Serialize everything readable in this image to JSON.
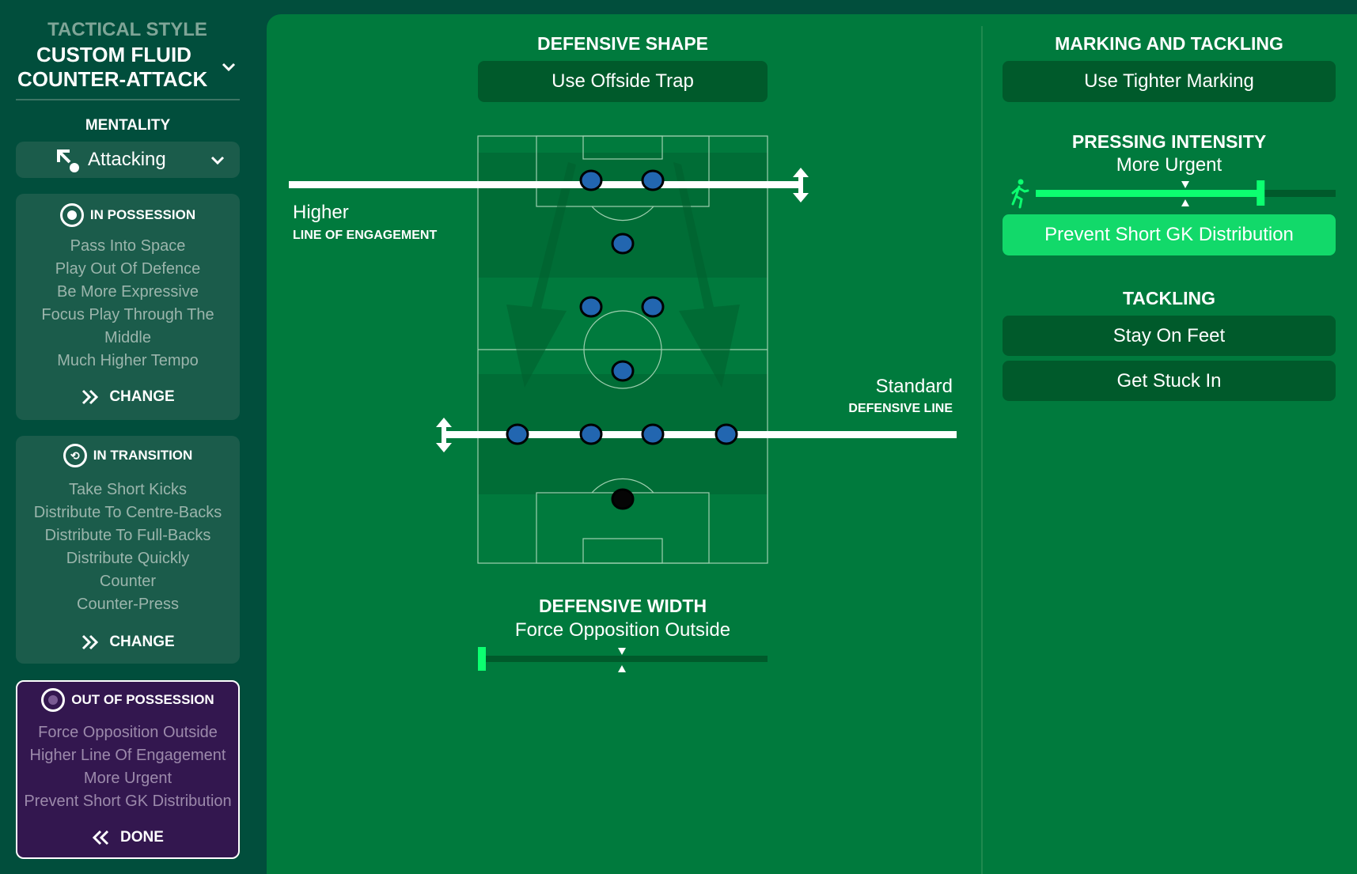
{
  "sidebar": {
    "tactical_style_label": "TACTICAL STYLE",
    "style_name_line1": "CUSTOM FLUID",
    "style_name_line2": "COUNTER-ATTACK",
    "mentality_label": "MENTALITY",
    "mentality_value": "Attacking",
    "in_possession": {
      "title": "IN POSSESSION",
      "items": [
        "Pass Into Space",
        "Play Out Of Defence",
        "Be More Expressive",
        "Focus Play Through The",
        "Middle",
        "Much Higher Tempo"
      ],
      "action": "CHANGE"
    },
    "in_transition": {
      "title": "IN TRANSITION",
      "items": [
        "Take Short Kicks",
        "Distribute To Centre-Backs",
        "Distribute To Full-Backs",
        "Distribute Quickly",
        "Counter",
        "Counter-Press"
      ],
      "action": "CHANGE"
    },
    "out_of_possession": {
      "title": "OUT OF POSSESSION",
      "items": [
        "Force Opposition Outside",
        "Higher Line Of Engagement",
        "More Urgent",
        "Prevent Short GK Distribution"
      ],
      "action": "DONE"
    }
  },
  "defensive_shape": {
    "title": "DEFENSIVE SHAPE",
    "offside_trap": "Use Offside Trap",
    "line_of_engagement_value": "Higher",
    "line_of_engagement_label": "LINE OF ENGAGEMENT",
    "defensive_line_value": "Standard",
    "defensive_line_label": "DEFENSIVE LINE",
    "formation_rows": [
      2,
      1,
      2,
      1,
      4,
      1
    ]
  },
  "defensive_width": {
    "title": "DEFENSIVE WIDTH",
    "value": "Force Opposition Outside",
    "level": 0
  },
  "marking": {
    "title": "MARKING AND TACKLING",
    "tighter_marking": "Use Tighter Marking",
    "pressing_title": "PRESSING INTENSITY",
    "pressing_value": "More Urgent",
    "pressing_level": 0.75,
    "gk_distribution": "Prevent Short GK Distribution",
    "tackling_title": "TACKLING",
    "stay_on_feet": "Stay On Feet",
    "get_stuck_in": "Get Stuck In"
  },
  "colors": {
    "accent": "#12d96a",
    "slider_fill": "#0cff70",
    "pitch": "#007a3d",
    "sidebar": "#014e3c",
    "oop_panel": "#33174f",
    "player": "#2266b0"
  }
}
